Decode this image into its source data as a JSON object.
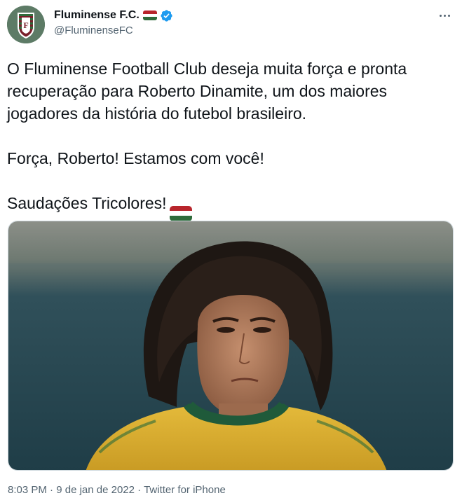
{
  "account": {
    "display_name": "Fluminense F.C.",
    "handle": "@FluminenseFC",
    "verified": true,
    "avatar_icon": "fluminense-crest-icon",
    "flag_icon": "tricolor-flag-icon",
    "verified_icon": "verified-badge-icon"
  },
  "menu": {
    "icon": "more-options-icon"
  },
  "tweet": {
    "paragraph_1": "O Fluminense Football Club deseja muita força e pronta recuperação para Roberto Dinamite, um dos maiores jogadores da história do futebol brasileiro.",
    "paragraph_2": "Força, Roberto! Estamos com você!",
    "paragraph_3": "Saudações Tricolores!",
    "emoji_icon": "tricolor-flag-icon"
  },
  "media": {
    "type": "photo"
  },
  "meta": {
    "time": "8:03 PM",
    "separator": "·",
    "date": "9 de jan de 2022",
    "source": "Twitter for iPhone"
  },
  "colors": {
    "flag_red": "#b8252c",
    "flag_white": "#ffffff",
    "flag_green": "#2f6b3b",
    "verified_blue": "#1d9bf0",
    "muted_text": "#536471",
    "body_text": "#0f1419"
  }
}
